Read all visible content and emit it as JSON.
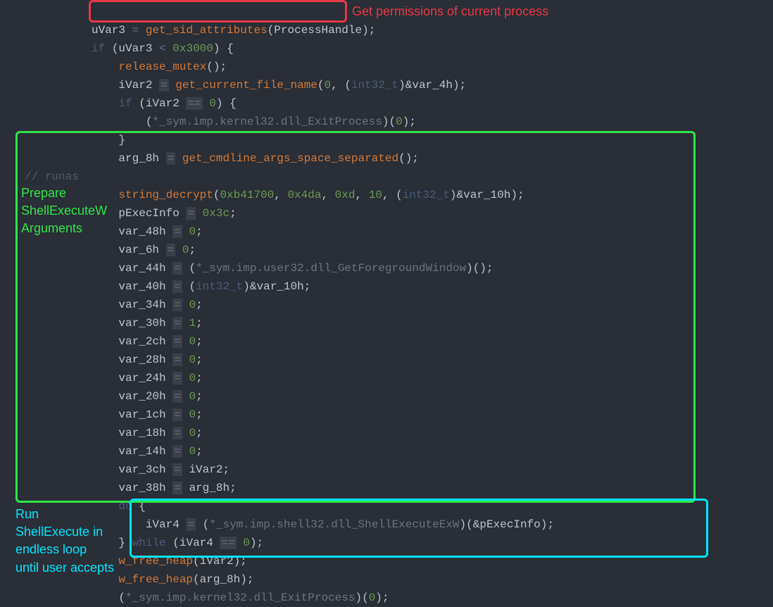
{
  "code": {
    "line1_var": "uVar3",
    "line1_func": "get_sid_attributes",
    "line1_arg": "ProcessHandle",
    "line2_kw": "if",
    "line2_var": "uVar3",
    "line2_hex": "0x3000",
    "line3_func": "release_mutex",
    "line4_var": "iVar2",
    "line4_func": "get_current_file_name",
    "line4_a1": "0",
    "line4_cast": "int32_t",
    "line4_a2": "var_4h",
    "line5_kw": "if",
    "line5_var": "iVar2",
    "line5_val": "0",
    "line6_sym": "*_sym.imp.kernel32.dll_ExitProcess",
    "line6_val": "0",
    "line8_var": "arg_8h",
    "line8_func": "get_cmdline_args_space_separated",
    "line9_comment": "// runas",
    "line11_func": "string_decrypt",
    "line11_a1": "0xb41700",
    "line11_a2": "0x4da",
    "line11_a3": "0xd",
    "line11_a4": "10",
    "line11_cast": "int32_t",
    "line11_a5": "var_10h",
    "line12_var": "pExecInfo",
    "line12_val": "0x3c",
    "line13_var": "var_48h",
    "line13_val": "0",
    "line14_var": "var_6h",
    "line14_val": "0",
    "line15_var": "var_44h",
    "line15_sym": "*_sym.imp.user32.dll_GetForegroundWindow",
    "line16_var": "var_40h",
    "line16_cast": "int32_t",
    "line16_val": "var_10h",
    "line17_var": "var_34h",
    "line17_val": "0",
    "line18_var": "var_30h",
    "line18_val": "1",
    "line19_var": "var_2ch",
    "line19_val": "0",
    "line20_var": "var_28h",
    "line20_val": "0",
    "line21_var": "var_24h",
    "line21_val": "0",
    "line22_var": "var_20h",
    "line22_val": "0",
    "line23_var": "var_1ch",
    "line23_val": "0",
    "line24_var": "var_18h",
    "line24_val": "0",
    "line25_var": "var_14h",
    "line25_val": "0",
    "line26_var": "var_3ch",
    "line26_val": "iVar2",
    "line27_var": "var_38h",
    "line27_val": "arg_8h",
    "line28_kw": "do",
    "line29_var": "iVar4",
    "line29_sym": "*_sym.imp.shell32.dll_ShellExecuteExW",
    "line29_arg": "pExecInfo",
    "line30_kw": "while",
    "line30_var": "iVar4",
    "line30_val": "0",
    "line31_func": "w_free_heap",
    "line31_arg": "iVar2",
    "line32_func": "w_free_heap",
    "line32_arg": "arg_8h",
    "line33_sym": "*_sym.imp.kernel32.dll_ExitProcess",
    "line33_val": "0"
  },
  "annotations": {
    "red": "Get permissions of current process",
    "green_l1": "Prepare",
    "green_l2": "ShellExecuteW",
    "green_l3": "Arguments",
    "cyan_l1": "Run",
    "cyan_l2": "ShellExecute in",
    "cyan_l3": "endless loop",
    "cyan_l4": "until user accepts"
  }
}
